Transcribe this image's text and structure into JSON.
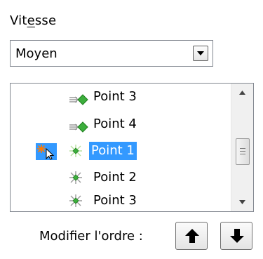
{
  "speed": {
    "label_prefix": "Vit",
    "label_underlined": "e",
    "label_suffix": "sse",
    "selected_value": "Moyen"
  },
  "animation_list": {
    "items": [
      {
        "label": "Point 3",
        "icon": "entrance-arrow-icon",
        "selected": false
      },
      {
        "label": "Point 4",
        "icon": "entrance-arrow-icon",
        "selected": false
      },
      {
        "label": "Point 1",
        "icon": "emphasis-sparkle-icon",
        "selected": true
      },
      {
        "label": "Point 2",
        "icon": "emphasis-sparkle-icon",
        "selected": false
      },
      {
        "label": "Point 3",
        "icon": "emphasis-sparkle-icon",
        "selected": false
      }
    ]
  },
  "reorder": {
    "label": "Modifier l'ordre :",
    "up_icon": "arrow-up-icon",
    "down_icon": "arrow-down-icon"
  },
  "colors": {
    "selection": "#3399ff",
    "icon_green": "#3cae3c"
  }
}
